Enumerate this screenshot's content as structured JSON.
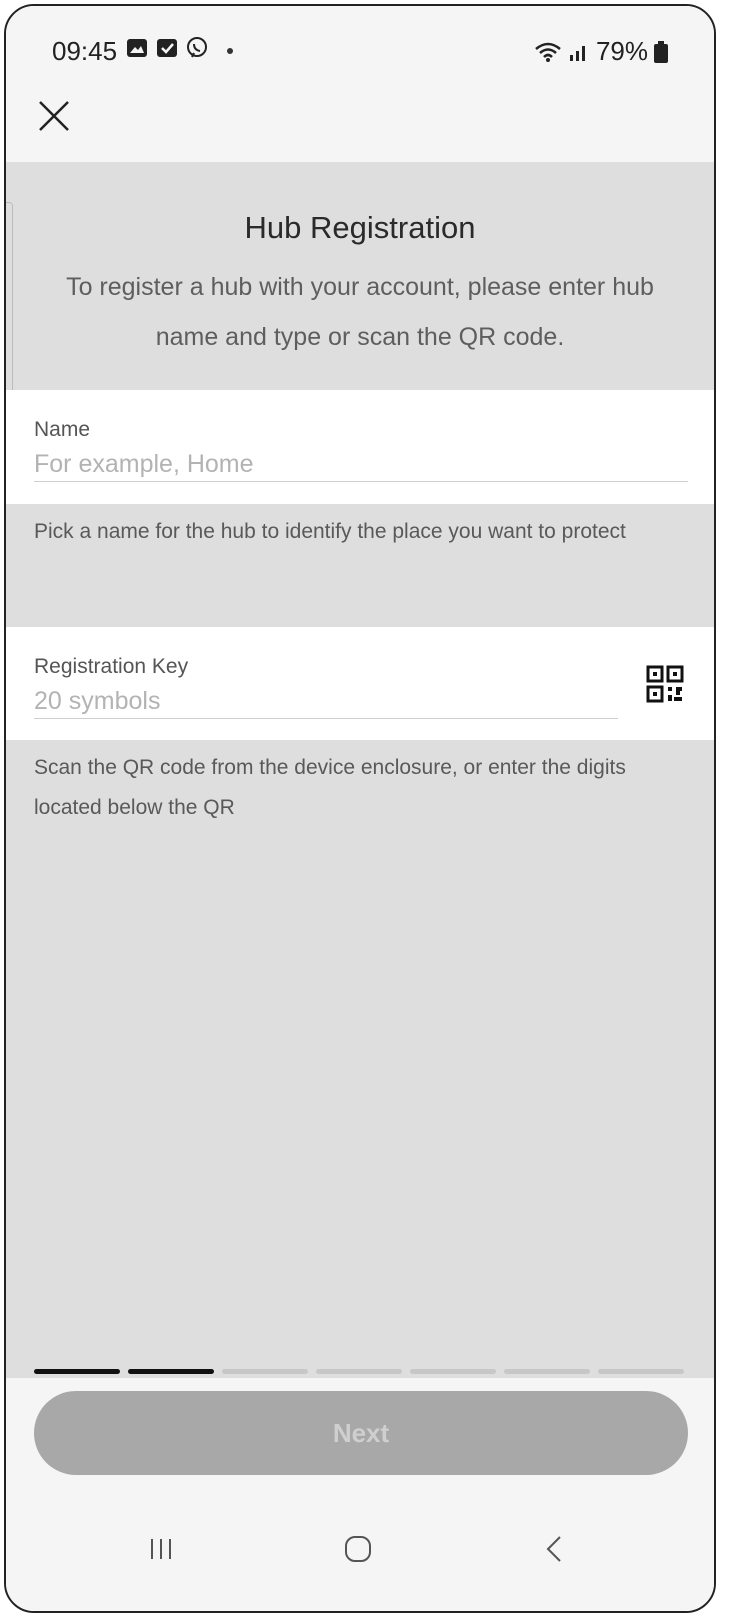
{
  "status_bar": {
    "time": "09:45",
    "battery": "79%",
    "icons": [
      "gallery-icon",
      "checkbox-icon",
      "viber-icon",
      "wifi-icon",
      "signal-icon",
      "battery-icon"
    ]
  },
  "toolbar": {
    "close_icon": "close-icon"
  },
  "header": {
    "title": "Hub Registration",
    "subtitle": "To register a hub with your account, please enter hub name and type or scan the QR code."
  },
  "name_field": {
    "label": "Name",
    "placeholder": "For example, Home",
    "value": "",
    "hint": "Pick a name for the hub to identify the place you want to protect"
  },
  "key_field": {
    "label": "Registration Key",
    "placeholder": "20 symbols",
    "value": "",
    "icon": "qr-code-icon",
    "hint": "Scan the QR code from the device enclosure, or enter the digits located below the QR"
  },
  "progress": {
    "total_steps": 7,
    "current_step": 2
  },
  "next_button": {
    "label": "Next",
    "enabled": false
  },
  "nav_bar": {
    "items": [
      "recent-apps-icon",
      "home-icon",
      "back-icon"
    ]
  },
  "colors": {
    "band": "#dedede",
    "surface": "#ffffff",
    "button_disabled": "#a8a8a8"
  }
}
